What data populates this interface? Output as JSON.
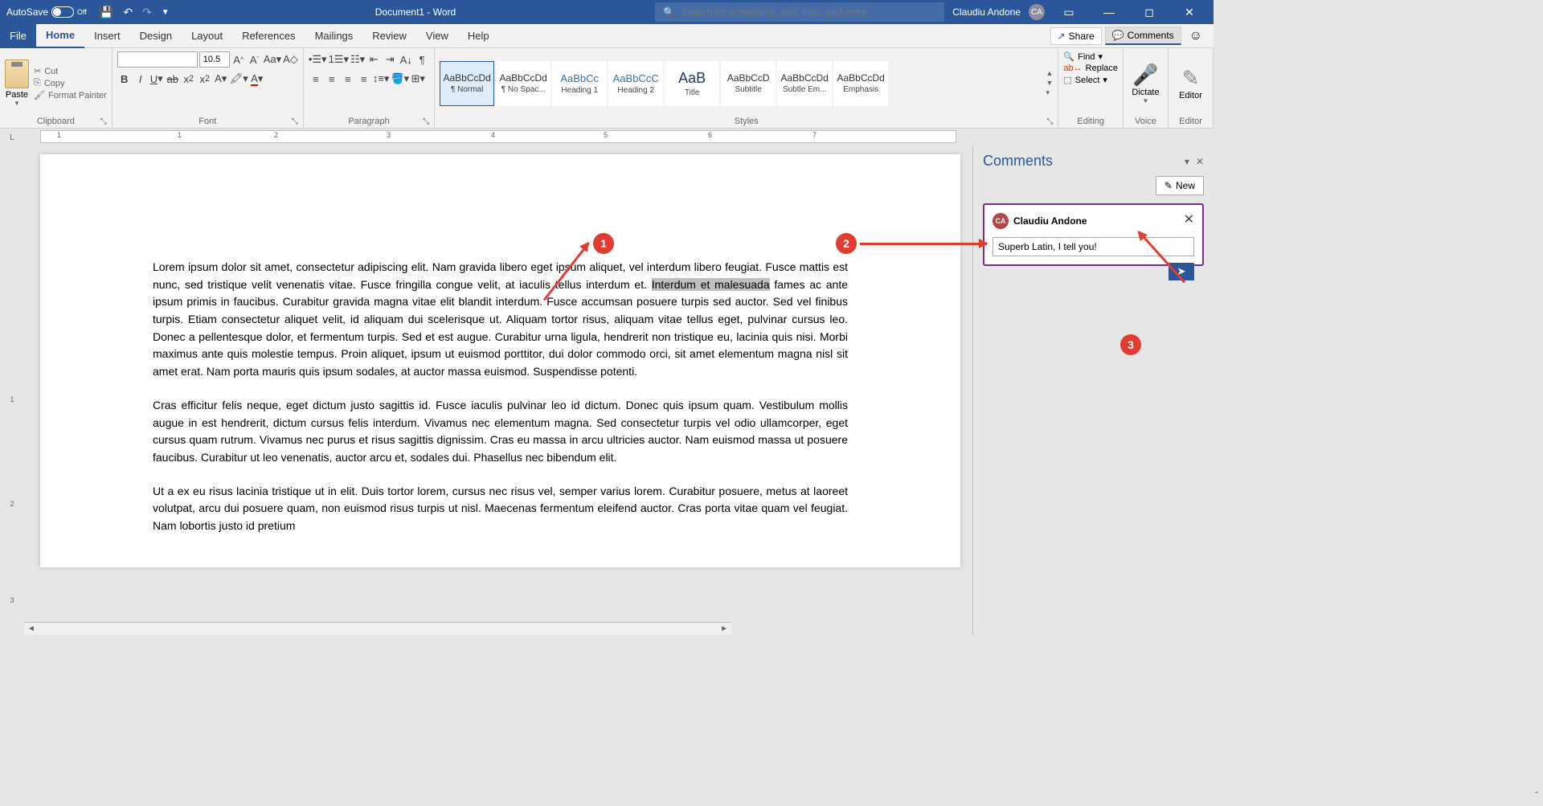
{
  "titleBar": {
    "autosave": "AutoSave",
    "autosaveState": "Off",
    "docTitle": "Document1 - Word",
    "searchPlaceholder": "Search for commands, text, help, and more",
    "userName": "Claudiu Andone",
    "userInitials": "CA"
  },
  "tabs": {
    "file": "File",
    "items": [
      "Home",
      "Insert",
      "Design",
      "Layout",
      "References",
      "Mailings",
      "Review",
      "View",
      "Help"
    ],
    "activeIndex": 0,
    "share": "Share",
    "comments": "Comments"
  },
  "ribbon": {
    "clipboard": {
      "paste": "Paste",
      "cut": "Cut",
      "copy": "Copy",
      "formatPainter": "Format Painter",
      "label": "Clipboard"
    },
    "font": {
      "fontName": "",
      "fontSize": "10.5",
      "label": "Font"
    },
    "paragraph": {
      "label": "Paragraph"
    },
    "styles": {
      "items": [
        {
          "preview": "AaBbCcDd",
          "name": "¶ Normal",
          "cls": ""
        },
        {
          "preview": "AaBbCcDd",
          "name": "¶ No Spac...",
          "cls": ""
        },
        {
          "preview": "AaBbCc",
          "name": "Heading 1",
          "cls": "heading"
        },
        {
          "preview": "AaBbCcC",
          "name": "Heading 2",
          "cls": "heading"
        },
        {
          "preview": "AaB",
          "name": "Title",
          "cls": "title"
        },
        {
          "preview": "AaBbCcD",
          "name": "Subtitle",
          "cls": ""
        },
        {
          "preview": "AaBbCcDd",
          "name": "Subtle Em...",
          "cls": ""
        },
        {
          "preview": "AaBbCcDd",
          "name": "Emphasis",
          "cls": ""
        }
      ],
      "label": "Styles"
    },
    "editing": {
      "find": "Find",
      "replace": "Replace",
      "select": "Select",
      "label": "Editing"
    },
    "voice": {
      "dictate": "Dictate",
      "label": "Voice"
    },
    "editor": {
      "editor": "Editor",
      "label": "Editor"
    }
  },
  "ruler": {
    "marks": [
      "1",
      "1",
      "2",
      "3",
      "4",
      "5",
      "6",
      "7"
    ]
  },
  "vruler": {
    "marks": [
      "1",
      "2",
      "3"
    ]
  },
  "document": {
    "para1_before": "Lorem ipsum dolor sit amet, consectetur adipiscing elit. Nam gravida libero eget ipsum aliquet, vel interdum libero feugiat. Fusce mattis est nunc, sed tristique velit venenatis vitae. Fusce fringilla congue velit, at iaculis tellus interdum et. ",
    "para1_highlight": "Interdum et malesuada",
    "para1_after": " fames ac ante ipsum primis in faucibus. Curabitur gravida magna vitae elit blandit interdum. Fusce accumsan posuere turpis sed auctor. Sed vel finibus turpis. Etiam consectetur aliquet velit, id aliquam dui scelerisque ut. Aliquam tortor risus, aliquam vitae tellus eget, pulvinar cursus leo. Donec a pellentesque dolor, et fermentum turpis. Sed et est augue. Curabitur urna ligula, hendrerit non tristique eu, lacinia quis nisi. Morbi maximus ante quis molestie tempus. Proin aliquet, ipsum ut euismod porttitor, dui dolor commodo orci, sit amet elementum magna nisl sit amet erat. Nam porta mauris quis ipsum sodales, at auctor massa euismod. Suspendisse potenti.",
    "para2": "Cras efficitur felis neque, eget dictum justo sagittis id. Fusce iaculis pulvinar leo id dictum. Donec quis ipsum quam. Vestibulum mollis augue in est hendrerit, dictum cursus felis interdum. Vivamus nec elementum magna. Sed consectetur turpis vel odio ullamcorper, eget cursus quam rutrum. Vivamus nec purus et risus sagittis dignissim. Cras eu massa in arcu ultricies auctor. Nam euismod massa ut posuere faucibus. Curabitur ut leo venenatis, auctor arcu et, sodales dui. Phasellus nec bibendum elit.",
    "para3": "Ut a ex eu risus lacinia tristique ut in elit. Duis tortor lorem, cursus nec risus vel, semper varius lorem. Curabitur posuere, metus at laoreet volutpat, arcu dui posuere quam, non euismod risus turpis ut nisl. Maecenas fermentum eleifend auctor. Cras porta vitae quam vel feugiat. Nam lobortis justo id pretium"
  },
  "commentsPane": {
    "title": "Comments",
    "newLabel": "New",
    "author": "Claudiu Andone",
    "authorInitials": "CA",
    "commentText": "Superb Latin, I tell you!"
  },
  "annotations": {
    "m1": "1",
    "m2": "2",
    "m3": "3"
  }
}
